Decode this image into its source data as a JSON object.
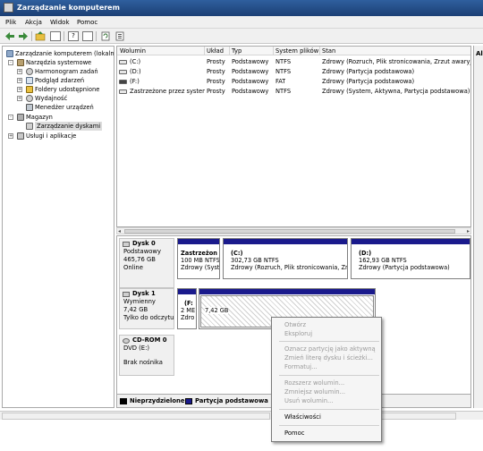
{
  "window": {
    "title": "Zarządzanie komputerem"
  },
  "menu": [
    "Plik",
    "Akcja",
    "Widok",
    "Pomoc"
  ],
  "toolbar": {
    "icons": [
      "back-arrow-icon",
      "forward-arrow-icon",
      "up-folder-icon",
      "show-hide-tree-icon",
      "help-icon",
      "properties-icon",
      "refresh-icon",
      "export-icon"
    ],
    "help_glyph": "?"
  },
  "tree": {
    "root": "Zarządzanie komputerem (lokalne)",
    "tools": "Narzędzia systemowe",
    "scheduler": "Harmonogram zadań",
    "events": "Podgląd zdarzeń",
    "shared": "Foldery udostępnione",
    "perf": "Wydajność",
    "devices": "Menedżer urządzeń",
    "storage": "Magazyn",
    "diskmgmt": "Zarządzanie dyskami",
    "services": "Usługi i aplikacje",
    "expand_plus": "+",
    "expand_minus": "-"
  },
  "volumes": {
    "headers": [
      "Wolumin",
      "Układ",
      "Typ",
      "System plików",
      "Stan"
    ],
    "rows": [
      {
        "name": "(C:)",
        "layout": "Prosty",
        "type": "Podstawowy",
        "fs": "NTFS",
        "status": "Zdrowy (Rozruch, Plik stronicowania, Zrzut awaryjny"
      },
      {
        "name": "(D:)",
        "layout": "Prosty",
        "type": "Podstawowy",
        "fs": "NTFS",
        "status": "Zdrowy (Partycja podstawowa)"
      },
      {
        "name": "(F:)",
        "layout": "Prosty",
        "type": "Podstawowy",
        "fs": "FAT",
        "status": "Zdrowy (Partycja podstawowa)"
      },
      {
        "name": "Zastrzeżone przez system",
        "layout": "Prosty",
        "type": "Podstawowy",
        "fs": "NTFS",
        "status": "Zdrowy (System, Aktywna, Partycja podstawowa)"
      }
    ]
  },
  "disks": {
    "disk0": {
      "name": "Dysk 0",
      "type": "Podstawowy",
      "size": "465,76 GB",
      "state": "Online",
      "parts": [
        {
          "label": "Zastrzeżon",
          "size": "100 MB NTFS",
          "status": "Zdrowy (Syst"
        },
        {
          "label": "(C:)",
          "size": "302,73 GB NTFS",
          "status": "Zdrowy (Rozruch, Plik stronicowania, Zrz"
        },
        {
          "label": "(D:)",
          "size": "162,93 GB NTFS",
          "status": "Zdrowy (Partycja podstawowa)"
        }
      ]
    },
    "disk1": {
      "name": "Dysk 1",
      "type": "Wymienny",
      "size": "7,42 GB",
      "state": "Tylko do odczytu",
      "parts": [
        {
          "label": "(F:",
          "size": "2 ME",
          "status": "Zdro"
        },
        {
          "label": "",
          "size": "7,42 GB",
          "status": ""
        }
      ]
    },
    "cdrom0": {
      "name": "CD-ROM 0",
      "drive": "DVD (E:)",
      "state": "Brak nośnika"
    }
  },
  "legend": {
    "unallocated": "Nieprzydzielone",
    "primary": "Partycja podstawowa",
    "unallocated_color": "#000000",
    "primary_color": "#1a1a8c"
  },
  "right_panel": {
    "title": "Al"
  },
  "context_menu": {
    "open": "Otwórz",
    "explore": "Eksploruj",
    "mark_active": "Oznacz partycję jako aktywną",
    "change_letter": "Zmień literę dysku i ścieżki...",
    "format": "Formatuj...",
    "extend": "Rozszerz wolumin...",
    "shrink": "Zmniejsz wolumin...",
    "delete": "Usuń wolumin...",
    "properties": "Właściwości",
    "help": "Pomoc"
  },
  "colors": {
    "accent_bar": "#1a1a8c",
    "title_bar": "#2f5f9e"
  }
}
